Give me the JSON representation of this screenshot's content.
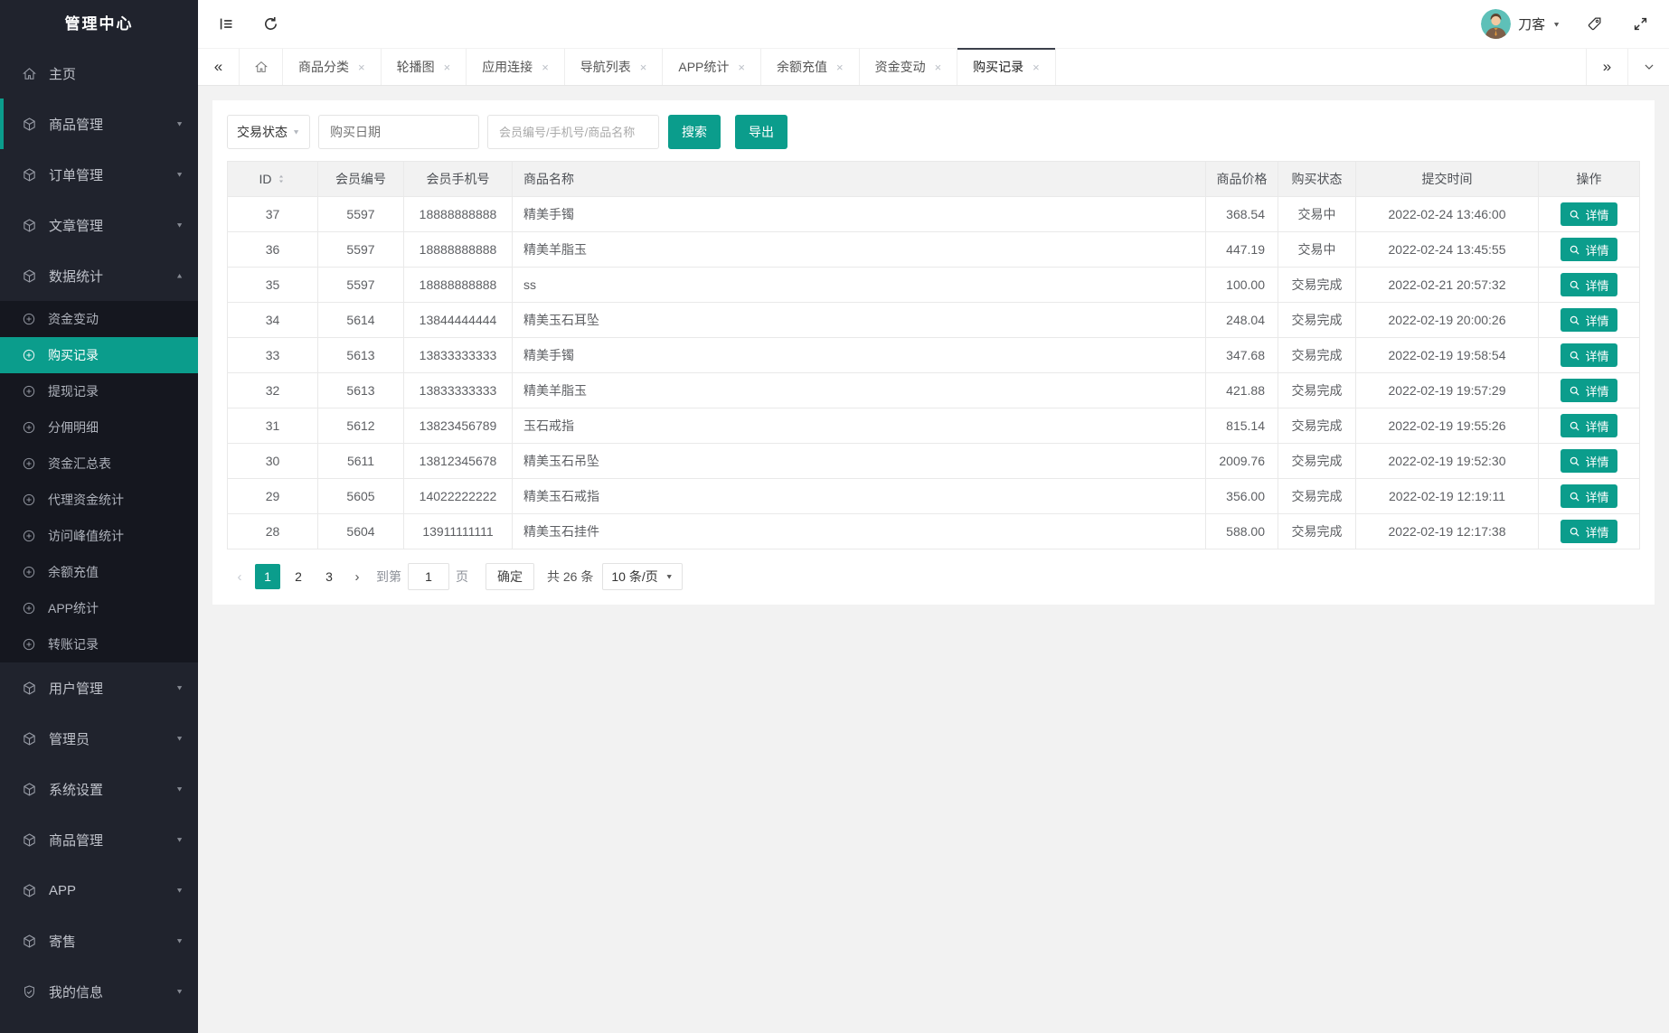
{
  "icons": {
    "caret_down": "▼",
    "caret_up": "▲",
    "close": "×",
    "chev_double_left": "«",
    "chev_double_right": "»",
    "chev_left": "‹",
    "chev_right": "›"
  },
  "colors": {
    "teal": "#0b9d8c",
    "sidebar_bg": "#20232d",
    "sidebar_sub_bg": "#15171f"
  },
  "sidebar": {
    "title": "管理中心",
    "items": [
      {
        "label": "主页"
      },
      {
        "label": "商品管理"
      },
      {
        "label": "订单管理"
      },
      {
        "label": "文章管理"
      },
      {
        "label": "数据统计"
      },
      {
        "label": "资金变动"
      },
      {
        "label": "购买记录"
      },
      {
        "label": "提现记录"
      },
      {
        "label": "分佣明细"
      },
      {
        "label": "资金汇总表"
      },
      {
        "label": "代理资金统计"
      },
      {
        "label": "访问峰值统计"
      },
      {
        "label": "余额充值"
      },
      {
        "label": "APP统计"
      },
      {
        "label": "转账记录"
      },
      {
        "label": "用户管理"
      },
      {
        "label": "管理员"
      },
      {
        "label": "系统设置"
      },
      {
        "label": "商品管理"
      },
      {
        "label": "APP"
      },
      {
        "label": "寄售"
      },
      {
        "label": "我的信息"
      }
    ]
  },
  "topbar": {
    "username": "刀客"
  },
  "tabs": {
    "items": [
      "商品分类",
      "轮播图",
      "应用连接",
      "导航列表",
      "APP统计",
      "余额充值",
      "资金变动",
      "购买记录"
    ],
    "active": "购买记录"
  },
  "filters": {
    "status": "交易状态",
    "date_placeholder": "购买日期",
    "search_placeholder": "会员编号/手机号/商品名称",
    "search_label": "搜索",
    "export_label": "导出"
  },
  "table": {
    "headers": [
      "ID",
      "会员编号",
      "会员手机号",
      "商品名称",
      "商品价格",
      "购买状态",
      "提交时间",
      "操作"
    ],
    "action_label": "详情",
    "rows": [
      {
        "id": "37",
        "member_no": "5597",
        "phone": "18888888888",
        "product": "精美手镯",
        "price": "368.54",
        "status": "交易中",
        "time": "2022-02-24 13:46:00"
      },
      {
        "id": "36",
        "member_no": "5597",
        "phone": "18888888888",
        "product": "精美羊脂玉",
        "price": "447.19",
        "status": "交易中",
        "time": "2022-02-24 13:45:55"
      },
      {
        "id": "35",
        "member_no": "5597",
        "phone": "18888888888",
        "product": "ss",
        "price": "100.00",
        "status": "交易完成",
        "time": "2022-02-21 20:57:32"
      },
      {
        "id": "34",
        "member_no": "5614",
        "phone": "13844444444",
        "product": "精美玉石耳坠",
        "price": "248.04",
        "status": "交易完成",
        "time": "2022-02-19 20:00:26"
      },
      {
        "id": "33",
        "member_no": "5613",
        "phone": "13833333333",
        "product": "精美手镯",
        "price": "347.68",
        "status": "交易完成",
        "time": "2022-02-19 19:58:54"
      },
      {
        "id": "32",
        "member_no": "5613",
        "phone": "13833333333",
        "product": "精美羊脂玉",
        "price": "421.88",
        "status": "交易完成",
        "time": "2022-02-19 19:57:29"
      },
      {
        "id": "31",
        "member_no": "5612",
        "phone": "13823456789",
        "product": "玉石戒指",
        "price": "815.14",
        "status": "交易完成",
        "time": "2022-02-19 19:55:26"
      },
      {
        "id": "30",
        "member_no": "5611",
        "phone": "13812345678",
        "product": "精美玉石吊坠",
        "price": "2009.76",
        "status": "交易完成",
        "time": "2022-02-19 19:52:30"
      },
      {
        "id": "29",
        "member_no": "5605",
        "phone": "14022222222",
        "product": "精美玉石戒指",
        "price": "356.00",
        "status": "交易完成",
        "time": "2022-02-19 12:19:11"
      },
      {
        "id": "28",
        "member_no": "5604",
        "phone": "13911111111",
        "product": "精美玉石挂件",
        "price": "588.00",
        "status": "交易完成",
        "time": "2022-02-19 12:17:38"
      }
    ]
  },
  "pagination": {
    "pages": [
      "1",
      "2",
      "3"
    ],
    "active": "1",
    "goto_label": "到第",
    "goto_value": "1",
    "page_unit": "页",
    "confirm_label": "确定",
    "total_label": "共 26 条",
    "per_page": "10 条/页"
  }
}
